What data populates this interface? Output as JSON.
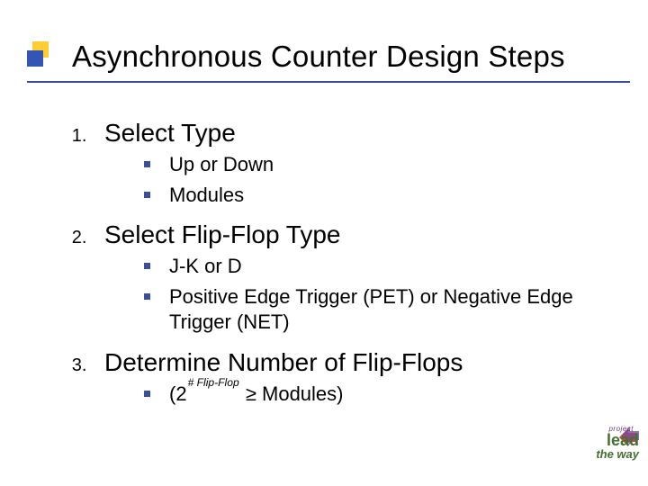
{
  "title": "Asynchronous Counter Design Steps",
  "items": [
    {
      "label": "Select Type",
      "sub": [
        "Up or Down",
        "Modules"
      ]
    },
    {
      "label": "Select Flip-Flop Type",
      "sub": [
        "J-K or D",
        "Positive Edge Trigger (PET) or Negative Edge Trigger (NET)"
      ]
    },
    {
      "label": "Determine Number of Flip-Flops",
      "sub_special": {
        "prefix": "(2",
        "exp": "# Flip-Flop",
        "suffix": " ≥ Modules)"
      }
    }
  ],
  "logo": {
    "project": "project",
    "lead": "lead",
    "theway": "the way"
  }
}
